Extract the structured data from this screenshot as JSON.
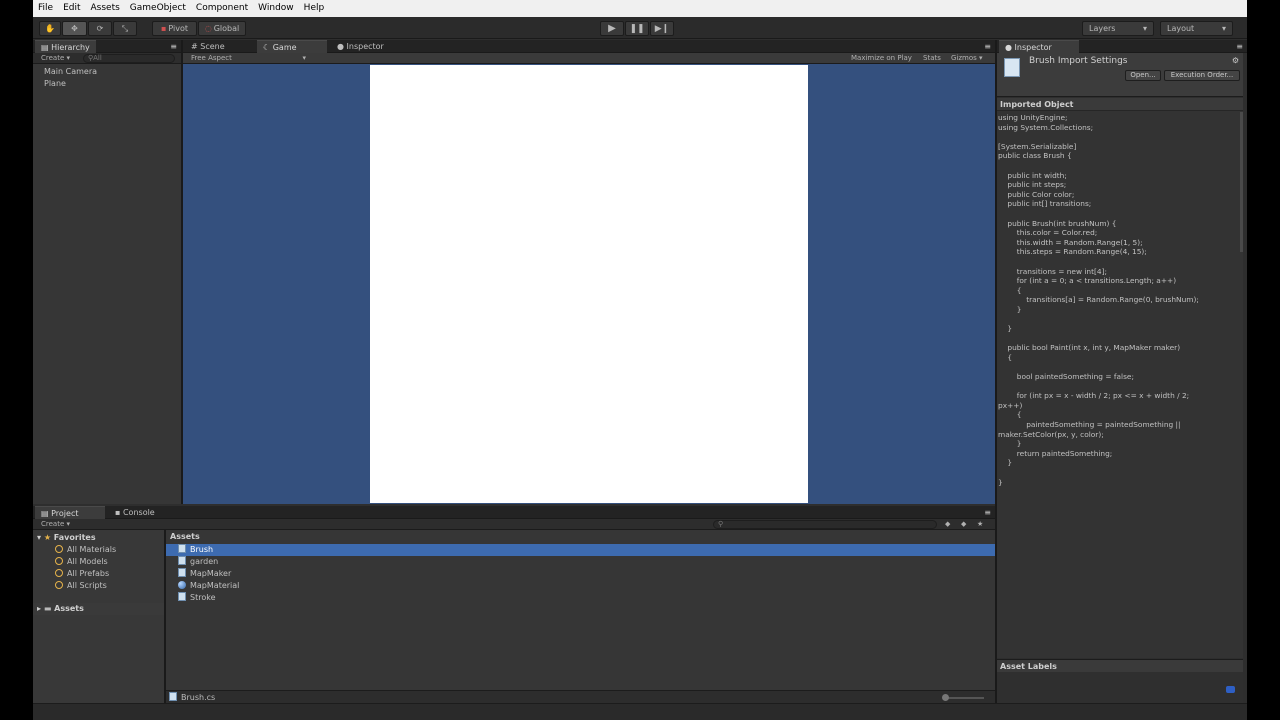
{
  "menubar": [
    "File",
    "Edit",
    "Assets",
    "GameObject",
    "Component",
    "Window",
    "Help"
  ],
  "toolbar": {
    "pivot": "Pivot",
    "global": "Global",
    "layers": "Layers",
    "layout": "Layout"
  },
  "hierarchy": {
    "tab": "Hierarchy",
    "create": "Create",
    "search_placeholder": "All",
    "items": [
      "Main Camera",
      "Plane"
    ]
  },
  "scene_tabs": {
    "scene": "Scene",
    "game": "Game",
    "inspector": "Inspector"
  },
  "game_bar": {
    "aspect": "Free Aspect",
    "maximize": "Maximize on Play",
    "stats": "Stats",
    "gizmos": "Gizmos"
  },
  "colors": {
    "game_bg": "#34507e",
    "game_canvas": "#ffffff",
    "selection": "#3d6bb0"
  },
  "inspector": {
    "tab": "Inspector",
    "title": "Brush Import Settings",
    "open_button": "Open...",
    "exec_order_button": "Execution Order...",
    "section": "Imported Object",
    "asset_labels": "Asset Labels",
    "code": [
      "using UnityEngine;",
      "using System.Collections;",
      "",
      "[System.Serializable]",
      "public class Brush {",
      "",
      "    public int width;",
      "    public int steps;",
      "    public Color color;",
      "    public int[] transitions;",
      "",
      "    public Brush(int brushNum) {",
      "        this.color = Color.red;",
      "        this.width = Random.Range(1, 5);",
      "        this.steps = Random.Range(4, 15);",
      "",
      "        transitions = new int[4];",
      "        for (int a = 0; a < transitions.Length; a++)",
      "        {",
      "            transitions[a] = Random.Range(0, brushNum);",
      "        }",
      "",
      "    }",
      "",
      "    public bool Paint(int x, int y, MapMaker maker)",
      "    {",
      "",
      "        bool paintedSomething = false;",
      "",
      "        for (int px = x - width / 2; px <= x + width / 2;",
      "px++)",
      "        {",
      "            paintedSomething = paintedSomething ||",
      "maker.SetColor(px, y, color);",
      "        }",
      "        return paintedSomething;",
      "    }",
      "",
      "}"
    ]
  },
  "project": {
    "tab": "Project",
    "console_tab": "Console",
    "create": "Create",
    "favorites_label": "Favorites",
    "favorites": [
      "All Materials",
      "All Models",
      "All Prefabs",
      "All Scripts"
    ],
    "assets_root": "Assets",
    "breadcrumb": "Assets",
    "assets": [
      {
        "name": "Brush",
        "icon": "script-icon",
        "selected": true
      },
      {
        "name": "garden",
        "icon": "scene-icon",
        "selected": false
      },
      {
        "name": "MapMaker",
        "icon": "script-icon",
        "selected": false
      },
      {
        "name": "MapMaterial",
        "icon": "material-icon",
        "selected": false
      },
      {
        "name": "Stroke",
        "icon": "script-icon",
        "selected": false
      }
    ],
    "footer_file": "Brush.cs"
  }
}
